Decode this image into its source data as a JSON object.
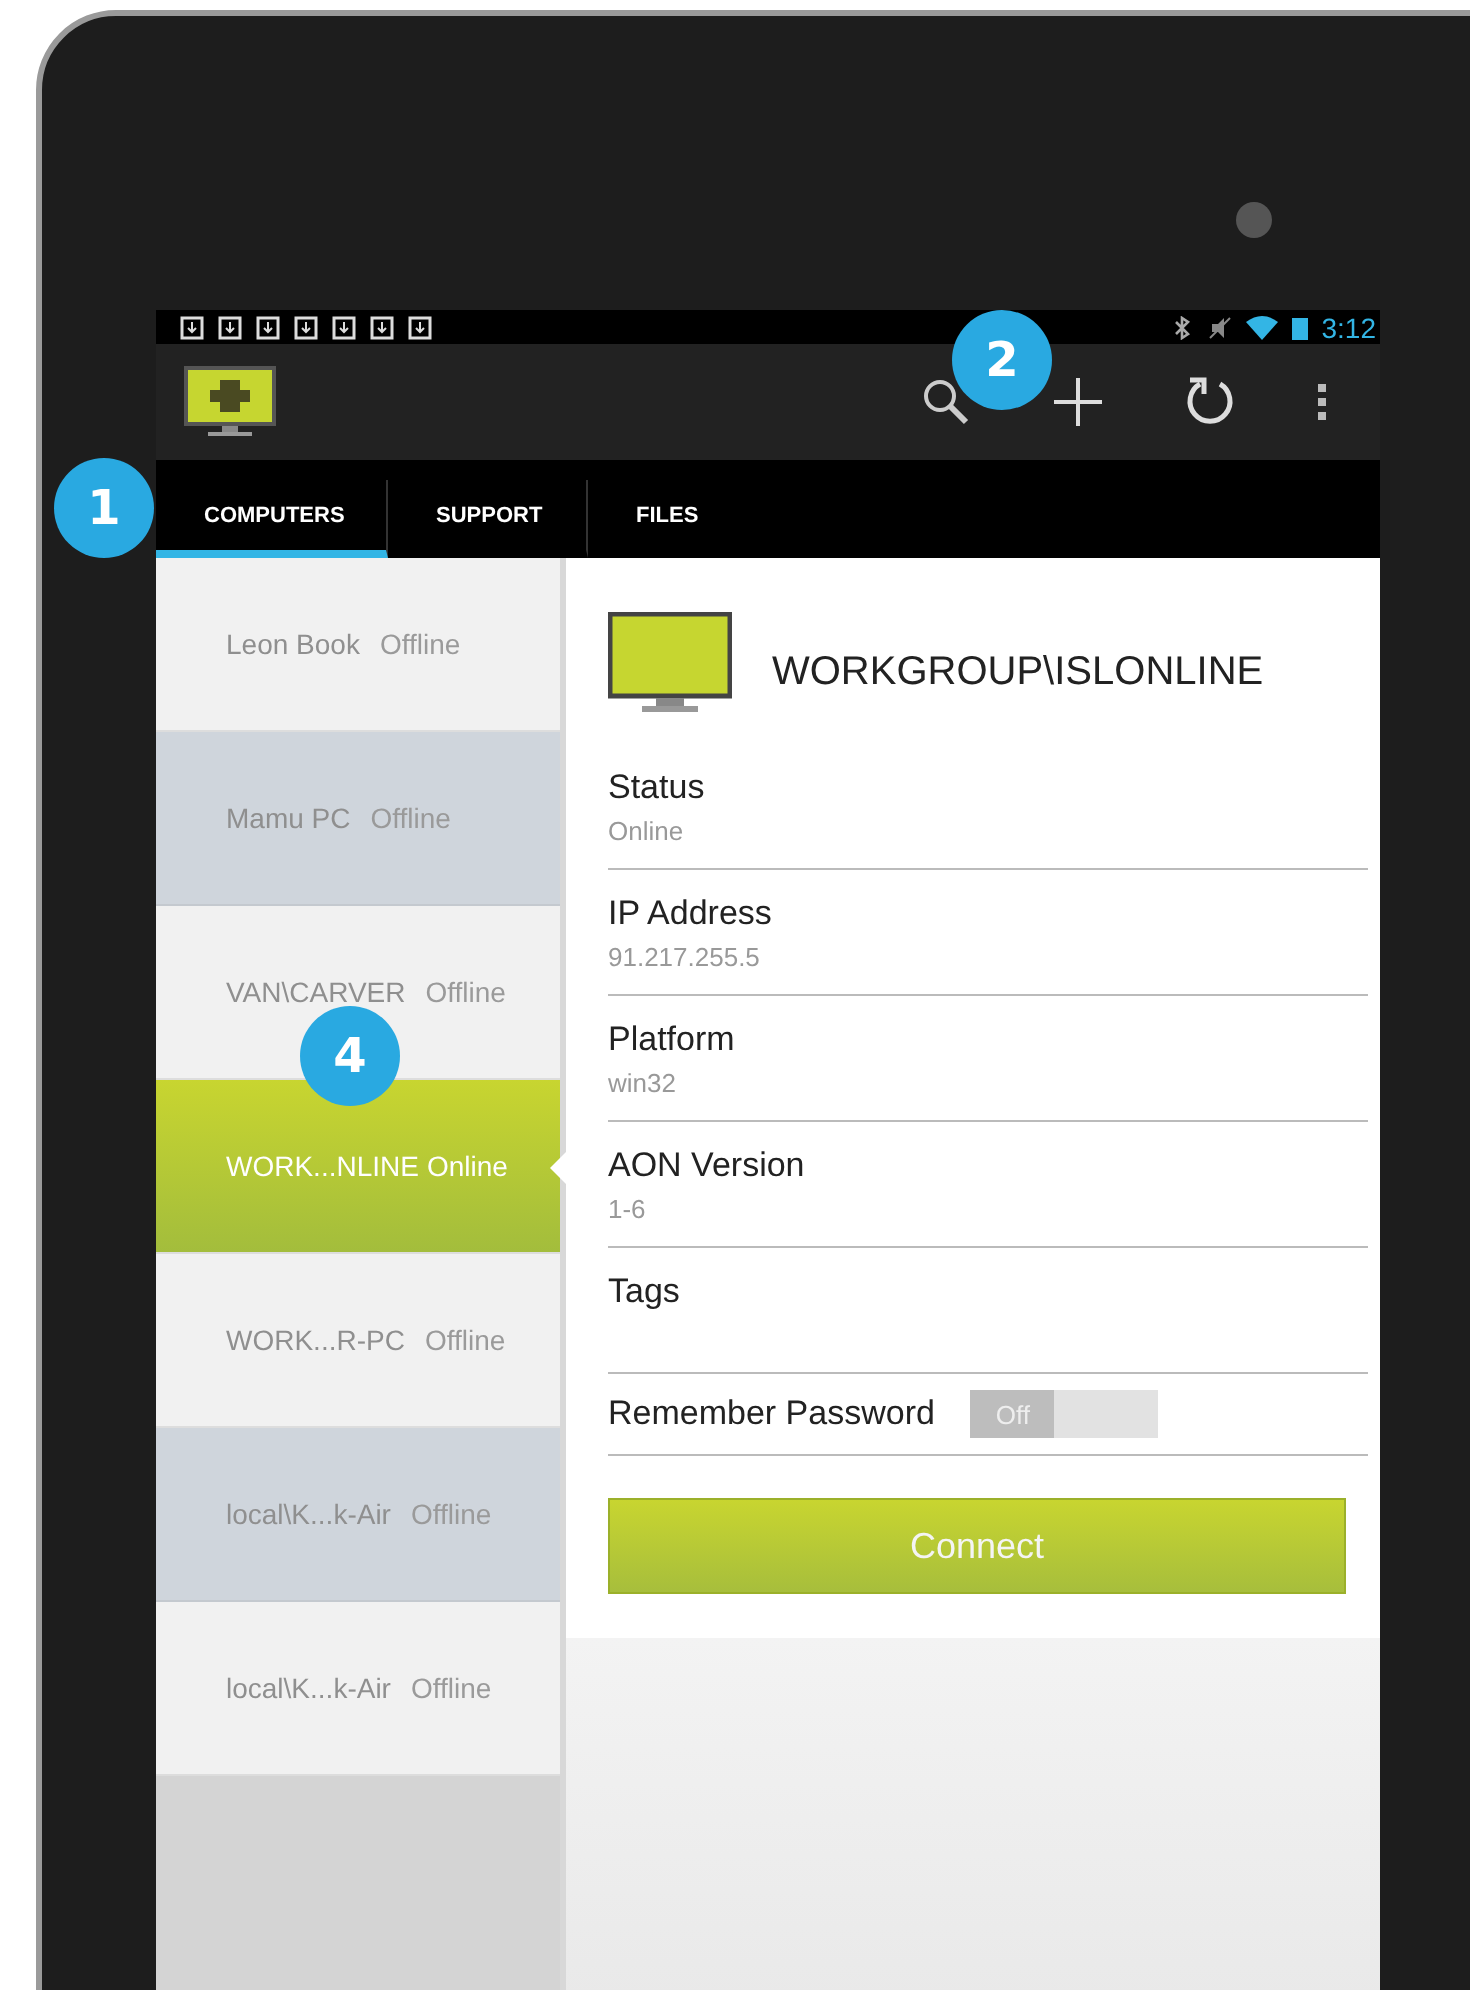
{
  "status_bar": {
    "time": "3:12"
  },
  "tabs": [
    {
      "label": "COMPUTERS",
      "selected": true
    },
    {
      "label": "SUPPORT",
      "selected": false
    },
    {
      "label": "FILES",
      "selected": false
    }
  ],
  "computers": [
    {
      "name": "Leon Book",
      "status": "Offline",
      "selected": false,
      "shaded": false
    },
    {
      "name": "Mamu PC",
      "status": "Offline",
      "selected": false,
      "shaded": true
    },
    {
      "name": "VAN\\CARVER",
      "status": "Offline",
      "selected": false,
      "shaded": false
    },
    {
      "name": "WORK...NLINE",
      "status": "Online",
      "selected": true,
      "shaded": false
    },
    {
      "name": "WORK...R-PC",
      "status": "Offline",
      "selected": false,
      "shaded": false
    },
    {
      "name": "local\\K...k-Air",
      "status": "Offline",
      "selected": false,
      "shaded": true
    },
    {
      "name": "local\\K...k-Air",
      "status": "Offline",
      "selected": false,
      "shaded": false
    }
  ],
  "detail": {
    "title": "WORKGROUP\\ISLONLINE",
    "fields": [
      {
        "label": "Status",
        "value": "Online"
      },
      {
        "label": "IP Address",
        "value": "91.217.255.5"
      },
      {
        "label": "Platform",
        "value": "win32"
      },
      {
        "label": "AON Version",
        "value": "1-6"
      },
      {
        "label": "Tags"
      }
    ],
    "remember_password": {
      "label": "Remember Password",
      "on": false,
      "state_text": "Off"
    },
    "connect_button": "Connect"
  },
  "callouts": [
    "1",
    "2",
    "4"
  ]
}
